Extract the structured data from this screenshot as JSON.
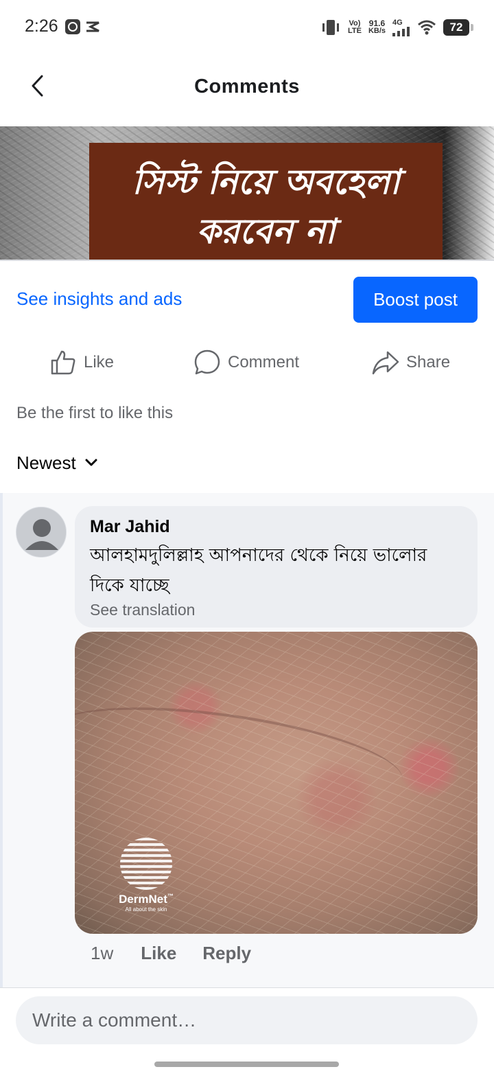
{
  "status_bar": {
    "time": "2:26",
    "volte": "Vo)",
    "lte": "LTE",
    "speed_value": "91.6",
    "speed_unit": "KB/s",
    "network": "4G",
    "battery": "72"
  },
  "header": {
    "title": "Comments"
  },
  "post": {
    "banner_line_1": "সিস্ট নিয়ে অবহেলা",
    "banner_line_2": "করবেন না"
  },
  "insights": {
    "link_label": "See insights and ads",
    "boost_label": "Boost post"
  },
  "actions": {
    "like": "Like",
    "comment": "Comment",
    "share": "Share"
  },
  "likes_summary": "Be the first to like this",
  "sort": {
    "selected": "Newest"
  },
  "comments": [
    {
      "author": "Mar Jahid",
      "text": "আলহামদুলিল্লাহ আপনাদের থেকে নিয়ে ভালোর দিকে যাচ্ছে",
      "see_translation": "See translation",
      "photo_watermark_name": "DermNet",
      "photo_watermark_tm": "™",
      "photo_watermark_tagline": "All about the skin",
      "time": "1w",
      "like_label": "Like",
      "reply_label": "Reply"
    }
  ],
  "composer": {
    "placeholder": "Write a comment…"
  },
  "colors": {
    "accent": "#0866ff",
    "secondary_text": "#65676b",
    "banner": "#6b2a14"
  },
  "icons": {
    "back": "chevron-left-icon",
    "like": "thumbs-up-icon",
    "comment": "speech-bubble-icon",
    "share": "share-arrow-icon",
    "sort": "chevron-down-icon"
  }
}
